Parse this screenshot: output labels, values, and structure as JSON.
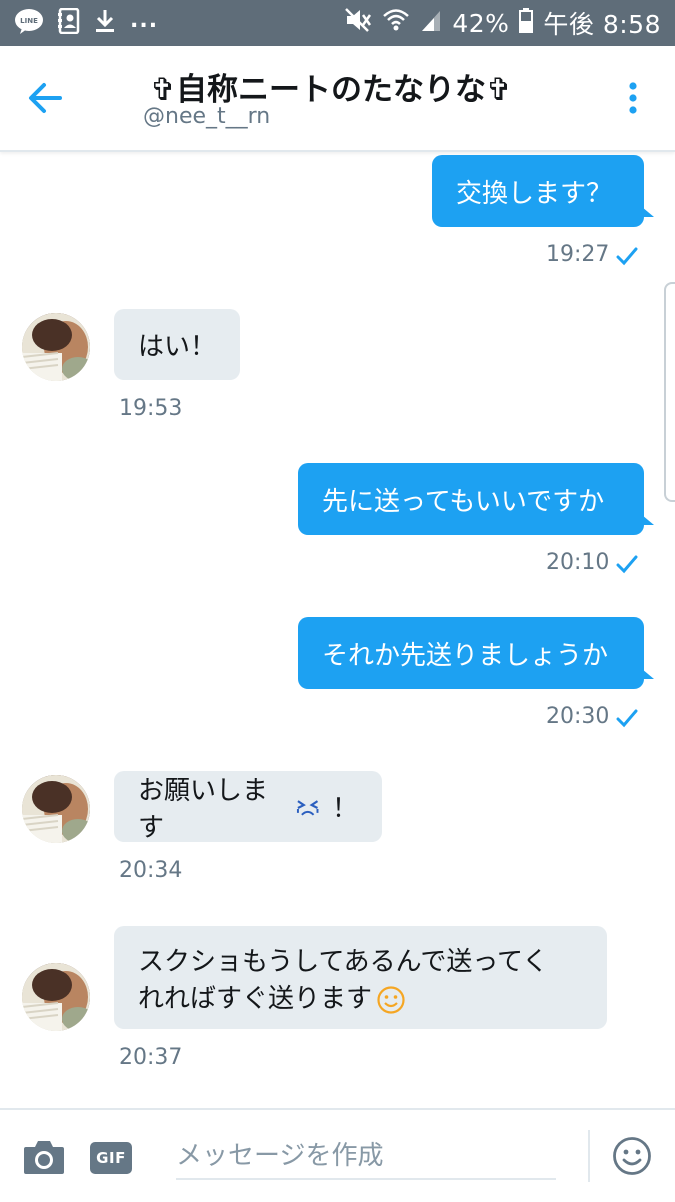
{
  "status_bar": {
    "battery": "42%",
    "time": "午後 8:58"
  },
  "header": {
    "title": "✞自称ニートのたなりな✞",
    "handle": "@nee_t__rn"
  },
  "messages": [
    {
      "id": "m1",
      "direction": "outgoing",
      "text": "交換します？",
      "time": "19:27",
      "read": true
    },
    {
      "id": "m2",
      "direction": "incoming",
      "text": "はい！",
      "time": "19:53"
    },
    {
      "id": "m3",
      "direction": "outgoing",
      "text": "先に送ってもいいですか",
      "time": "20:10",
      "read": true
    },
    {
      "id": "m4",
      "direction": "outgoing",
      "text": "それか先送りましょうか",
      "time": "20:30",
      "read": true
    },
    {
      "id": "m5",
      "direction": "incoming",
      "text": "お願いします",
      "suffix": "！",
      "emoji": "tearful-face",
      "time": "20:34"
    },
    {
      "id": "m6",
      "direction": "incoming",
      "line1": "スクショもうしてあるんで送ってく",
      "line2": "れればすぐ送ります",
      "emoji": "smiling-face",
      "time": "20:37"
    }
  ],
  "composer": {
    "placeholder": "メッセージを作成",
    "gif_label": "GIF"
  },
  "colors": {
    "accent": "#1da1f2",
    "incoming_bubble": "#e6ecf0",
    "status_bar": "#5f6d79"
  },
  "icons": [
    "line-app-icon",
    "contacts-icon",
    "download-icon",
    "mute-icon",
    "wifi-icon",
    "signal-icon",
    "battery-icon",
    "back-arrow-icon",
    "more-vert-icon",
    "check-icon",
    "camera-icon",
    "gif-icon",
    "emoji-icon"
  ]
}
